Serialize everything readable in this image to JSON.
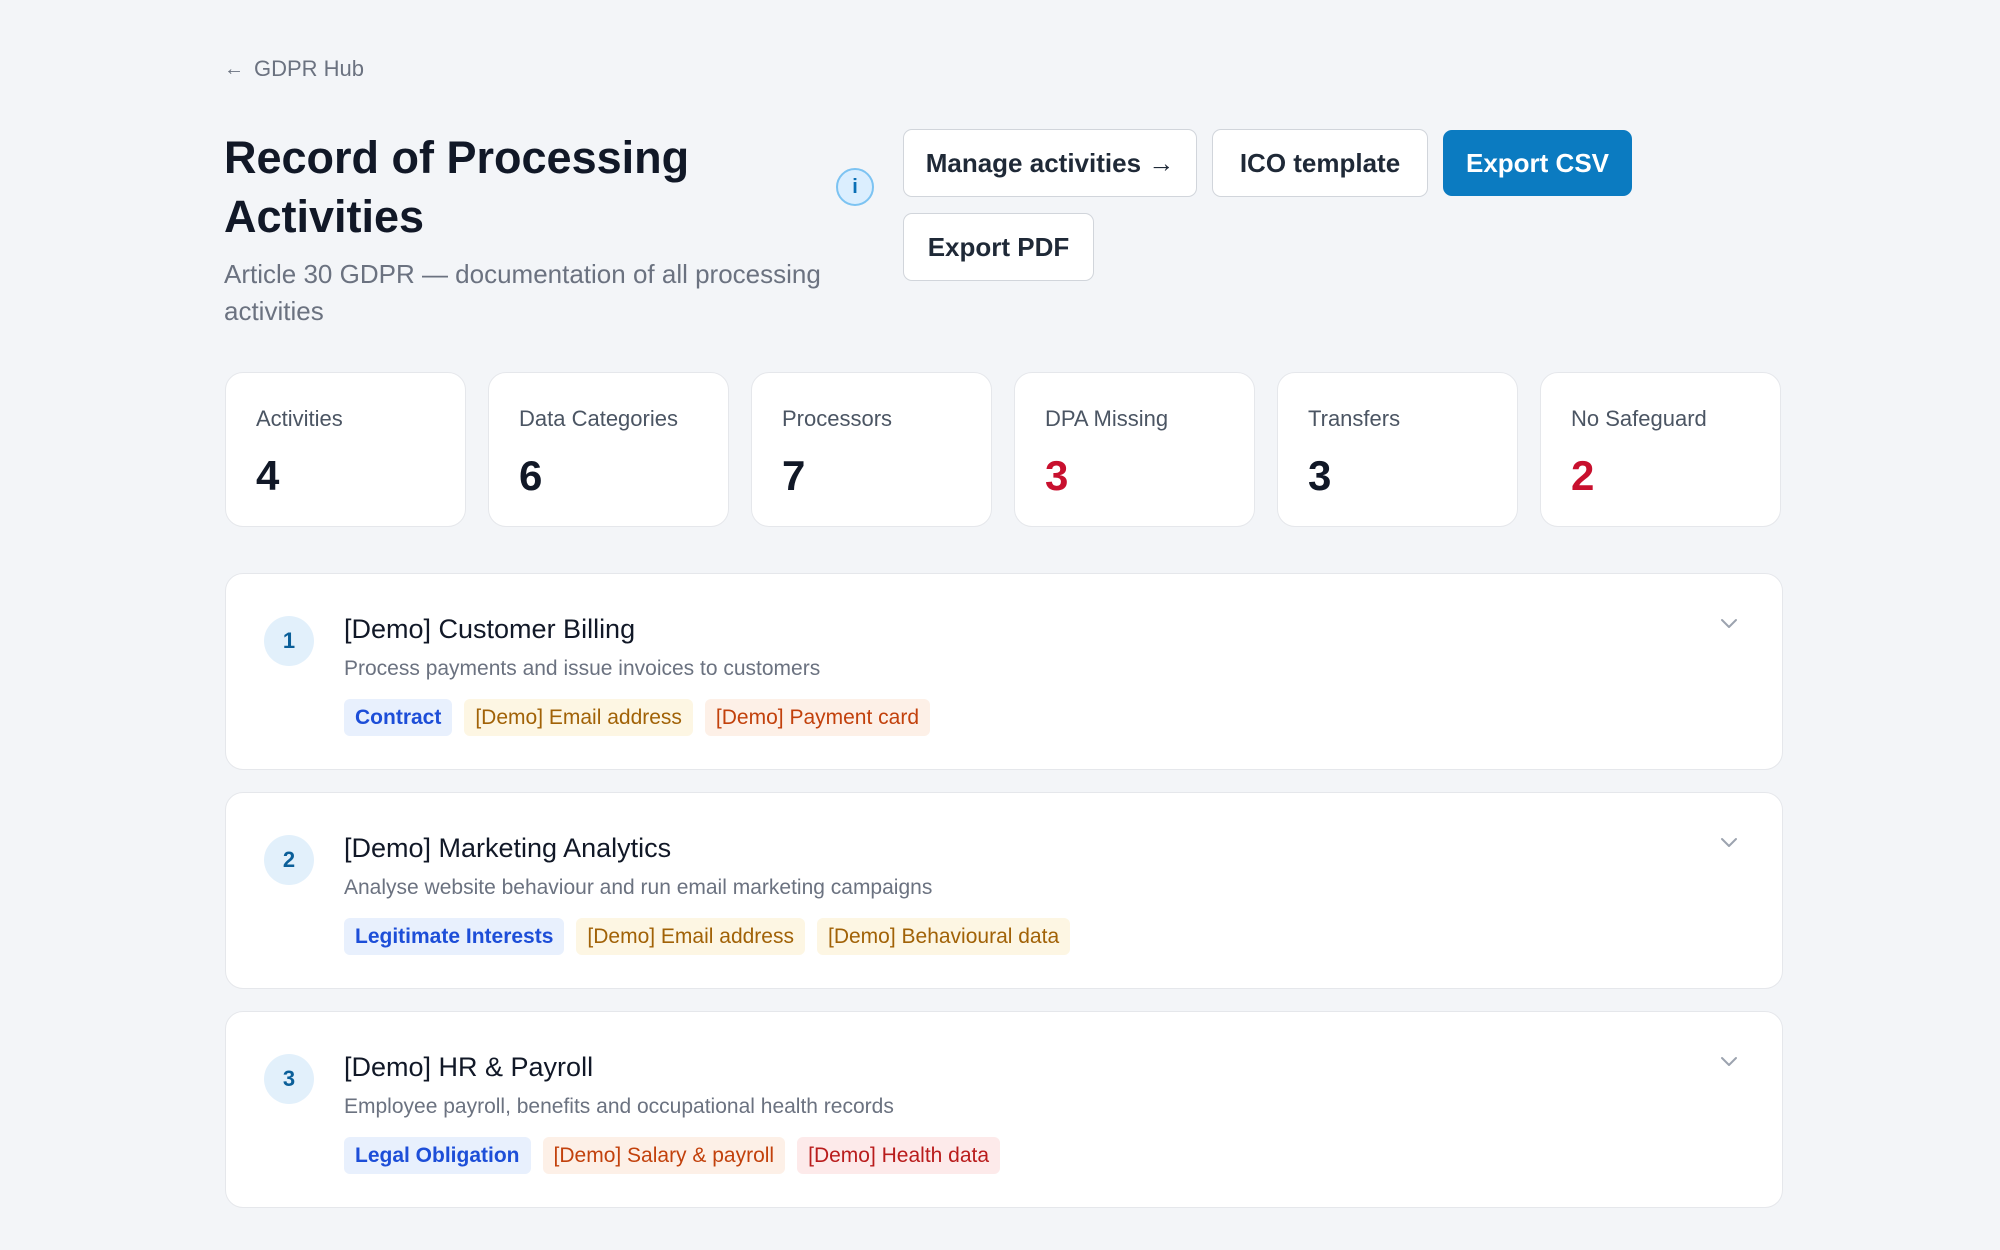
{
  "nav": {
    "back_arrow": "←",
    "back_label": "GDPR Hub"
  },
  "header": {
    "title": "Record of Processing Activities",
    "subtitle": "Article 30 GDPR — documentation of all processing activities",
    "info_label": "i"
  },
  "toolbar": {
    "manage_label": "Manage activities →",
    "ico_label": "ICO template",
    "export_csv_label": "Export CSV",
    "export_pdf_label": "Export PDF"
  },
  "stats": [
    {
      "label": "Activities",
      "value": "4",
      "alert": false
    },
    {
      "label": "Data Categories",
      "value": "6",
      "alert": false
    },
    {
      "label": "Processors",
      "value": "7",
      "alert": false
    },
    {
      "label": "DPA Missing",
      "value": "3",
      "alert": true
    },
    {
      "label": "Transfers",
      "value": "3",
      "alert": false
    },
    {
      "label": "No Safeguard",
      "value": "2",
      "alert": true
    }
  ],
  "activities": [
    {
      "number": "1",
      "name": "[Demo] Customer Billing",
      "description": "Process payments and issue invoices to customers",
      "legal_basis": "Contract",
      "categories": [
        {
          "label": "[Demo] Email address",
          "tone": "yellow"
        },
        {
          "label": "[Demo] Payment card",
          "tone": "orange"
        }
      ]
    },
    {
      "number": "2",
      "name": "[Demo] Marketing Analytics",
      "description": "Analyse website behaviour and run email marketing campaigns",
      "legal_basis": "Legitimate Interests",
      "categories": [
        {
          "label": "[Demo] Email address",
          "tone": "yellow"
        },
        {
          "label": "[Demo] Behavioural data",
          "tone": "yellow"
        }
      ]
    },
    {
      "number": "3",
      "name": "[Demo] HR & Payroll",
      "description": "Employee payroll, benefits and occupational health records",
      "legal_basis": "Legal Obligation",
      "categories": [
        {
          "label": "[Demo] Salary & payroll",
          "tone": "orange"
        },
        {
          "label": "[Demo] Health data",
          "tone": "red"
        }
      ]
    }
  ],
  "icons": {
    "info": "info-icon",
    "expand": "chevron-down-icon",
    "back": "arrow-left-icon"
  },
  "colors": {
    "primary": "#0b7bc1",
    "alert": "#c8102e",
    "background": "#f3f5f8"
  }
}
